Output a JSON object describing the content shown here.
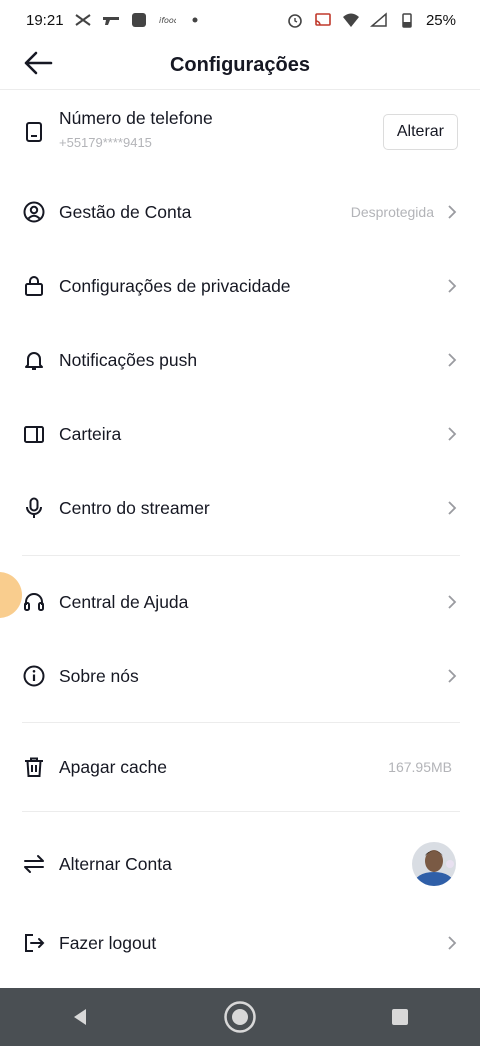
{
  "status_bar": {
    "time": "19:21",
    "battery": "25%"
  },
  "header": {
    "title": "Configurações"
  },
  "phone": {
    "label": "Número de telefone",
    "number": "+55179****9415",
    "button_label": "Alterar"
  },
  "items": {
    "account": {
      "label": "Gestão de Conta",
      "value": "Desprotegida"
    },
    "privacy": {
      "label": "Configurações de privacidade"
    },
    "push": {
      "label": "Notificações push"
    },
    "wallet": {
      "label": "Carteira"
    },
    "streamer": {
      "label": "Centro do streamer"
    },
    "help": {
      "label": "Central de Ajuda"
    },
    "about": {
      "label": "Sobre nós"
    },
    "cache": {
      "label": "Apagar cache",
      "value": "167.95MB"
    },
    "switch": {
      "label": "Alternar Conta"
    },
    "logout": {
      "label": "Fazer logout"
    }
  },
  "icons": {
    "back": "arrow-left-icon",
    "phone": "phone-icon",
    "account": "user-circle-icon",
    "privacy": "lock-icon",
    "push": "bell-icon",
    "wallet": "wallet-icon",
    "streamer": "microphone-icon",
    "help": "headset-icon",
    "about": "info-icon",
    "cache": "trash-icon",
    "switch": "swap-arrows-icon",
    "logout": "logout-icon"
  },
  "colors": {
    "text": "#161823",
    "muted": "#b3b4b8",
    "divider": "#ececec",
    "navbar": "#4a4f53"
  }
}
